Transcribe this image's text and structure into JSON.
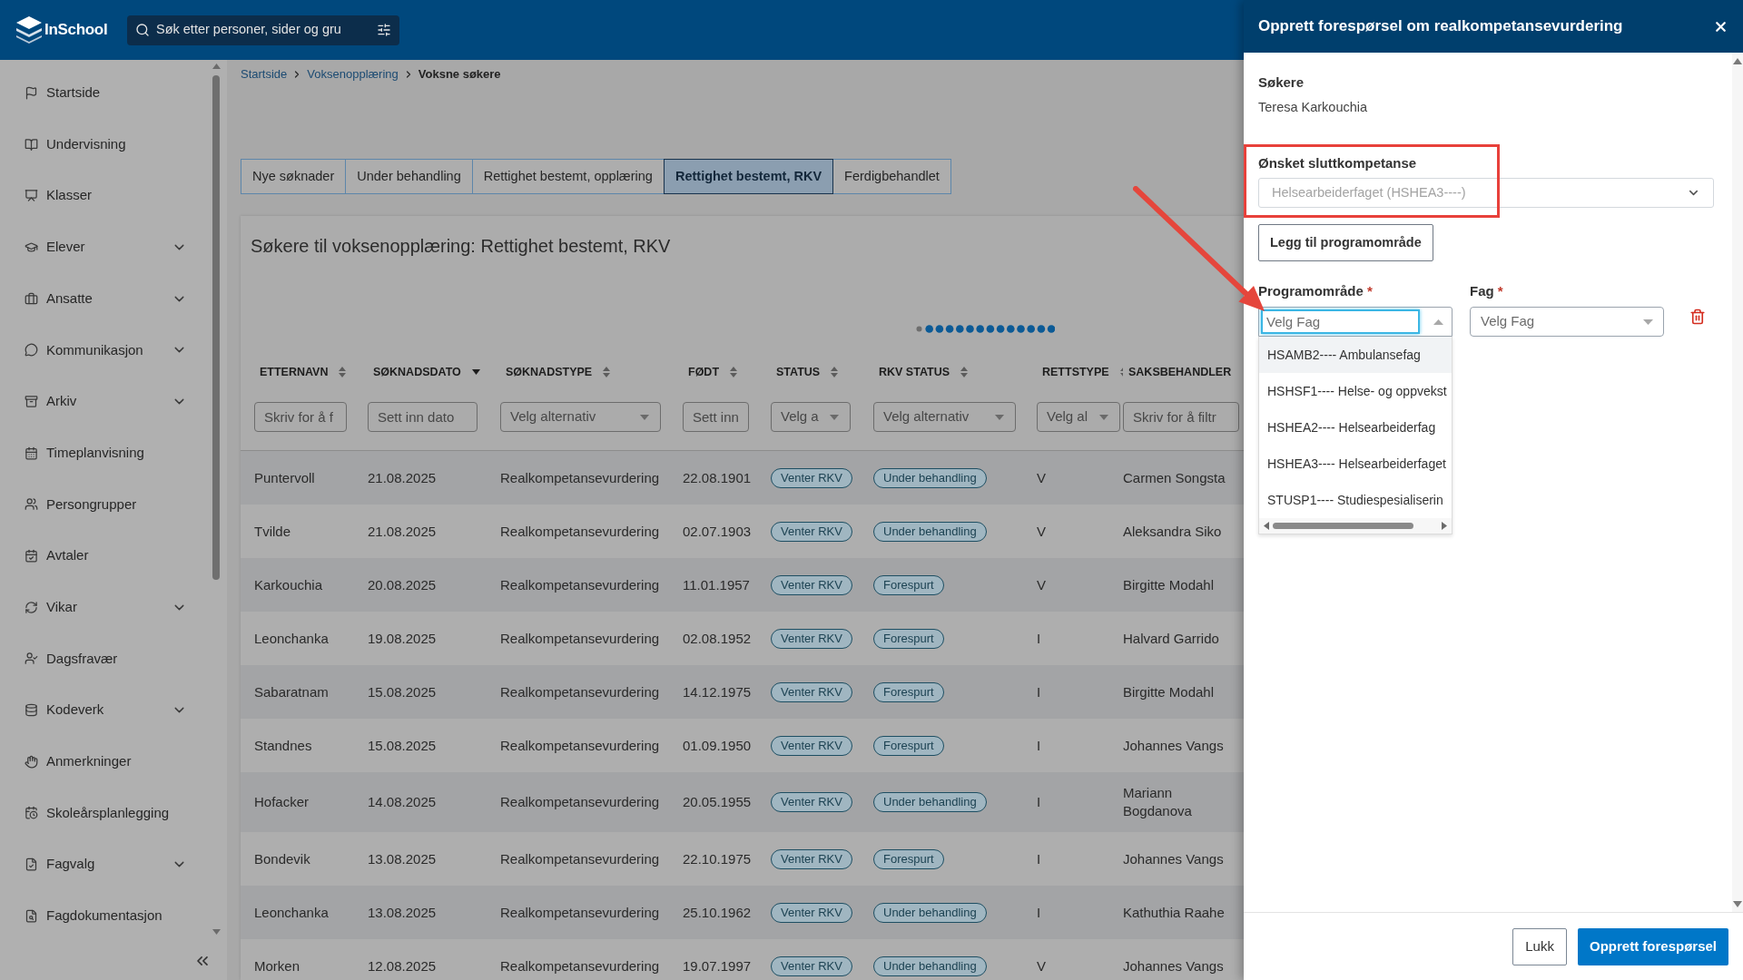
{
  "header": {
    "logo_text": "InSchool",
    "search": {
      "placeholder": "Søk etter personer, sider og gru"
    }
  },
  "sidebar": {
    "items": [
      {
        "label": "Startside",
        "kind": "link"
      },
      {
        "label": "Undervisning",
        "kind": "link"
      },
      {
        "label": "Klasser",
        "kind": "link"
      },
      {
        "label": "Elever",
        "kind": "group"
      },
      {
        "label": "Ansatte",
        "kind": "group"
      },
      {
        "label": "Kommunikasjon",
        "kind": "group"
      },
      {
        "label": "Arkiv",
        "kind": "group"
      },
      {
        "label": "Timeplanvisning",
        "kind": "link"
      },
      {
        "label": "Persongrupper",
        "kind": "link"
      },
      {
        "label": "Avtaler",
        "kind": "link"
      },
      {
        "label": "Vikar",
        "kind": "group"
      },
      {
        "label": "Dagsfravær",
        "kind": "link"
      },
      {
        "label": "Kodeverk",
        "kind": "group"
      },
      {
        "label": "Anmerkninger",
        "kind": "link"
      },
      {
        "label": "Skoleårsplanlegging",
        "kind": "link"
      },
      {
        "label": "Fagvalg",
        "kind": "group"
      },
      {
        "label": "Fagdokumentasjon",
        "kind": "link"
      }
    ]
  },
  "breadcrumb": [
    {
      "label": "Startside",
      "kind": "link"
    },
    {
      "label": "Voksenopplæring",
      "kind": "link"
    },
    {
      "label": "Voksne søkere",
      "kind": "current"
    }
  ],
  "tabs": [
    {
      "label": "Nye søknader",
      "selected": false
    },
    {
      "label": "Under behandling",
      "selected": false
    },
    {
      "label": "Rettighet bestemt, opplæring",
      "selected": false
    },
    {
      "label": "Rettighet bestemt, RKV",
      "selected": true
    },
    {
      "label": "Ferdigbehandlet",
      "selected": false
    }
  ],
  "results": {
    "title": "Søkere til voksenopplæring: Rettighet bestemt, RKV",
    "columns": [
      {
        "label": "ETTERNAVN",
        "sorted": false,
        "kind": "text",
        "filter": {
          "kind": "text",
          "placeholder": "Skriv for å f"
        }
      },
      {
        "label": "SØKNADSDATO",
        "sorted": true,
        "kind": "text",
        "filter": {
          "kind": "date",
          "placeholder": "Sett inn dato"
        }
      },
      {
        "label": "SØKNADSTYPE",
        "sorted": false,
        "kind": "text",
        "filter": {
          "kind": "select",
          "placeholder": "Velg alternativ"
        }
      },
      {
        "label": "FØDT",
        "sorted": false,
        "kind": "text",
        "filter": {
          "kind": "date",
          "placeholder": "Sett inn"
        }
      },
      {
        "label": "STATUS",
        "sorted": false,
        "kind": "badge",
        "filter": {
          "kind": "select",
          "placeholder": "Velg a"
        }
      },
      {
        "label": "RKV STATUS",
        "sorted": false,
        "kind": "badge",
        "filter": {
          "kind": "select",
          "placeholder": "Velg alternativ"
        }
      },
      {
        "label": "RETTSTYPE",
        "sorted": false,
        "kind": "text",
        "filter": {
          "kind": "select",
          "placeholder": "Velg al"
        }
      },
      {
        "label": "SAKSBEHANDLER",
        "kind": "text",
        "filter": {
          "kind": "text",
          "placeholder": "Skriv for å filtr"
        }
      }
    ],
    "rows": [
      {
        "cells": [
          "Puntervoll",
          "21.08.2025",
          "Realkompetansevurdering",
          "22.08.1901",
          "Venter RKV",
          "Under behandling",
          "V",
          "Carmen Songsta"
        ]
      },
      {
        "cells": [
          "Tvilde",
          "21.08.2025",
          "Realkompetansevurdering",
          "02.07.1903",
          "Venter RKV",
          "Under behandling",
          "V",
          "Aleksandra Siko"
        ]
      },
      {
        "cells": [
          "Karkouchia",
          "20.08.2025",
          "Realkompetansevurdering",
          "11.01.1957",
          "Venter RKV",
          "Forespurt",
          "V",
          "Birgitte Modahl"
        ]
      },
      {
        "cells": [
          "Leonchanka",
          "19.08.2025",
          "Realkompetansevurdering",
          "02.08.1952",
          "Venter RKV",
          "Forespurt",
          "I",
          "Halvard Garrido"
        ]
      },
      {
        "cells": [
          "Sabaratnam",
          "15.08.2025",
          "Realkompetansevurdering",
          "14.12.1975",
          "Venter RKV",
          "Forespurt",
          "I",
          "Birgitte Modahl"
        ]
      },
      {
        "cells": [
          "Standnes",
          "15.08.2025",
          "Realkompetansevurdering",
          "01.09.1950",
          "Venter RKV",
          "Forespurt",
          "I",
          "Johannes Vangs"
        ]
      },
      {
        "cells": [
          "Hofacker",
          "14.08.2025",
          "Realkompetansevurdering",
          "20.05.1955",
          "Venter RKV",
          "Under behandling",
          "I",
          "Mariann Bogdanova"
        ]
      },
      {
        "cells": [
          "Bondevik",
          "13.08.2025",
          "Realkompetansevurdering",
          "22.10.1975",
          "Venter RKV",
          "Forespurt",
          "I",
          "Johannes Vangs"
        ]
      },
      {
        "cells": [
          "Leonchanka",
          "13.08.2025",
          "Realkompetansevurdering",
          "25.10.1962",
          "Venter RKV",
          "Under behandling",
          "I",
          "Kathuthia Raahe"
        ]
      },
      {
        "cells": [
          "Morken",
          "12.08.2025",
          "Realkompetansevurdering",
          "19.07.1997",
          "Venter RKV",
          "Under behandling",
          "V",
          "Johannes Vangs"
        ]
      }
    ]
  },
  "dialog": {
    "title": "Opprett forespørsel om realkompetansevurdering",
    "applicants": {
      "label": "Søkere",
      "value": "Teresa Karkouchia"
    },
    "target_competence": {
      "label": "Ønsket sluttkompetanse",
      "value": "Helsearbeiderfaget (HSHEA3----)",
      "disabled": true
    },
    "add_button": "Legg til programområde",
    "program_area": {
      "label": "Programområde",
      "required_mark": "*",
      "placeholder": "Velg Fag",
      "focused": true,
      "expanded": true,
      "options": [
        {
          "label": "HSAMB2---- Ambulansefag",
          "active": true
        },
        {
          "label": "HSHSF1---- Helse- og oppvekst",
          "active": false
        },
        {
          "label": "HSHEA2---- Helsearbeiderfag",
          "active": false
        },
        {
          "label": "HSHEA3---- Helsearbeiderfaget",
          "active": false
        },
        {
          "label": "STUSP1---- Studiespesialiserin",
          "active": false
        }
      ]
    },
    "subject": {
      "label": "Fag",
      "required_mark": "*",
      "placeholder": "Velg Fag",
      "expanded": false
    },
    "buttons": [
      {
        "label": "Lukk",
        "kind": "secondary"
      },
      {
        "label": "Opprett forespørsel",
        "kind": "primary"
      }
    ]
  },
  "annotations": [
    {
      "kind": "frame"
    },
    {
      "kind": "arrow"
    }
  ]
}
